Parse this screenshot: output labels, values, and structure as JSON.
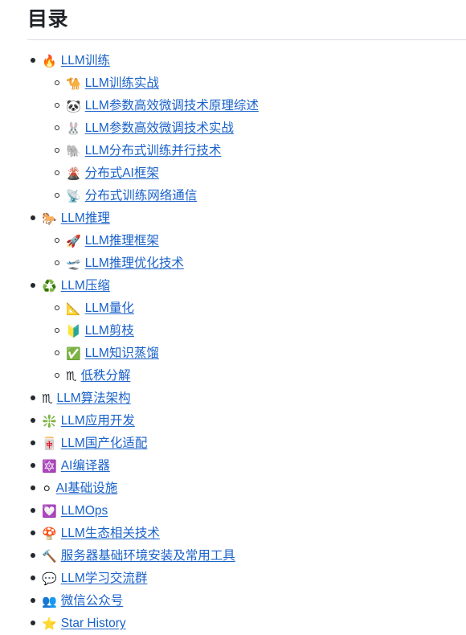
{
  "page": {
    "heading": "目录",
    "link_color": "#1a62c9",
    "heading_color": "#1f2328",
    "rule_color": "#d8dce1",
    "background": "#ffffff"
  },
  "toc": {
    "items": [
      {
        "emoji": "🔥",
        "emoji_name": "fire-icon",
        "label": "LLM训练",
        "children": [
          {
            "emoji": "🐪",
            "emoji_name": "camel-icon",
            "label": "LLM训练实战"
          },
          {
            "emoji": "🐼",
            "emoji_name": "panda-icon",
            "label": "LLM参数高效微调技术原理综述"
          },
          {
            "emoji": "🐰",
            "emoji_name": "rabbit-icon",
            "label": "LLM参数高效微调技术实战"
          },
          {
            "emoji": "🐘",
            "emoji_name": "elephant-icon",
            "label": "LLM分布式训练并行技术"
          },
          {
            "emoji": "🌋",
            "emoji_name": "volcano-icon",
            "label": "分布式AI框架"
          },
          {
            "emoji": "📡",
            "emoji_name": "satellite-antenna-icon",
            "label": "分布式训练网络通信"
          }
        ]
      },
      {
        "emoji": "🐎",
        "emoji_name": "horse-icon",
        "label": "LLM推理",
        "children": [
          {
            "emoji": "🚀",
            "emoji_name": "rocket-icon",
            "label": "LLM推理框架"
          },
          {
            "emoji": "🛫",
            "emoji_name": "airplane-departure-icon",
            "label": "LLM推理优化技术"
          }
        ]
      },
      {
        "emoji": "♻️",
        "emoji_name": "recycle-icon",
        "label": "LLM压缩",
        "children": [
          {
            "emoji": "📐",
            "emoji_name": "triangular-ruler-icon",
            "label": "LLM量化"
          },
          {
            "emoji": "🔰",
            "emoji_name": "beginner-badge-icon",
            "label": "LLM剪枝"
          },
          {
            "emoji": "✅",
            "emoji_name": "check-mark-icon",
            "label": "LLM知识蒸馏"
          },
          {
            "emoji": "♏",
            "emoji_name": "scorpio-icon",
            "label": "低秩分解"
          }
        ]
      },
      {
        "emoji": "♏",
        "emoji_name": "scorpio-icon",
        "label": "LLM算法架构",
        "children": []
      },
      {
        "emoji": "❇️",
        "emoji_name": "sparkle-icon",
        "label": "LLM应用开发",
        "children": []
      },
      {
        "emoji": "🀄",
        "emoji_name": "mahjong-red-dragon-icon",
        "label": "LLM国产化适配",
        "children": []
      },
      {
        "emoji": "🔯",
        "emoji_name": "six-pointed-star-icon",
        "label": "AI编译器",
        "children": []
      },
      {
        "emoji": "⚪",
        "emoji_name": "white-circle-icon",
        "label": "AI基础设施",
        "children": []
      },
      {
        "emoji": "💟",
        "emoji_name": "heart-decoration-icon",
        "label": "LLMOps",
        "children": []
      },
      {
        "emoji": "🍄",
        "emoji_name": "mushroom-icon",
        "label": "LLM生态相关技术",
        "children": []
      },
      {
        "emoji": "🔨",
        "emoji_name": "hammer-icon",
        "label": "服务器基础环境安装及常用工具",
        "children": []
      },
      {
        "emoji": "💬",
        "emoji_name": "speech-balloon-icon",
        "label": "LLM学习交流群",
        "children": []
      },
      {
        "emoji": "👥",
        "emoji_name": "busts-in-silhouette-icon",
        "label": "微信公众号",
        "children": []
      },
      {
        "emoji": "⭐",
        "emoji_name": "star-icon",
        "label": "Star History",
        "children": []
      }
    ]
  }
}
